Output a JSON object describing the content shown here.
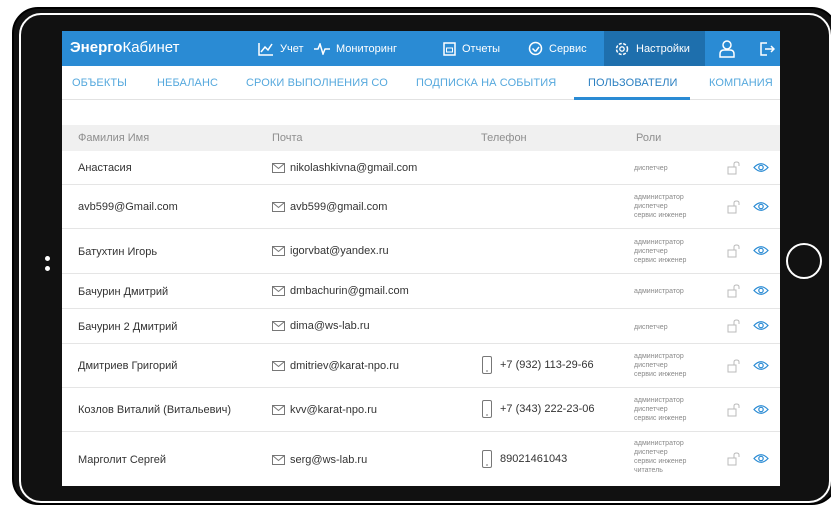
{
  "app": {
    "brand_bold": "Энерго",
    "brand_rest": "Кабинет"
  },
  "nav": {
    "items": [
      {
        "label": "Учет",
        "icon": "chart-icon"
      },
      {
        "label": "Мониторинг",
        "icon": "pulse-icon"
      },
      {
        "label": "Отчеты",
        "icon": "report-icon"
      },
      {
        "label": "Сервис",
        "icon": "service-icon"
      },
      {
        "label": "Настройки",
        "icon": "gear-icon",
        "active": true
      }
    ],
    "user_icon": "user-icon",
    "logout_icon": "logout-icon"
  },
  "tabs": [
    {
      "label": "ОБЪЕКТЫ"
    },
    {
      "label": "НЕБАЛАНС"
    },
    {
      "label": "СРОКИ ВЫПОЛНЕНИЯ СО"
    },
    {
      "label": "ПОДПИСКА НА СОБЫТИЯ"
    },
    {
      "label": "ПОЛЬЗОВАТЕЛИ",
      "active": true
    },
    {
      "label": "КОМПАНИЯ"
    }
  ],
  "table": {
    "headers": {
      "name": "Фамилия Имя",
      "email": "Почта",
      "phone": "Телефон",
      "roles": "Роли"
    },
    "rows": [
      {
        "name": "Анастасия",
        "email": "nikolashkivna@gmail.com",
        "phone": "",
        "roles": [
          "диспетчер"
        ]
      },
      {
        "name": "avb599@Gmail.com",
        "email": "avb599@gmail.com",
        "phone": "",
        "roles": [
          "администратор",
          "диспетчер",
          "сервис инженер"
        ]
      },
      {
        "name": "Батухтин Игорь",
        "email": "igorvbat@yandex.ru",
        "phone": "",
        "roles": [
          "администратор",
          "диспетчер",
          "сервис инженер"
        ]
      },
      {
        "name": "Бачурин Дмитрий",
        "email": "dmbachurin@gmail.com",
        "phone": "",
        "roles": [
          "администратор"
        ]
      },
      {
        "name": "Бачурин 2 Дмитрий",
        "email": "dima@ws-lab.ru",
        "phone": "",
        "roles": [
          "диспетчер"
        ]
      },
      {
        "name": "Дмитриев Григорий",
        "email": "dmitriev@karat-npo.ru",
        "phone": "+7 (932) 113-29-66",
        "roles": [
          "администратор",
          "диспетчер",
          "сервис инженер"
        ]
      },
      {
        "name": "Козлов Виталий (Витальевич)",
        "email": "kvv@karat-npo.ru",
        "phone": "+7 (343) 222-23-06",
        "roles": [
          "администратор",
          "диспетчер",
          "сервис инженер"
        ]
      },
      {
        "name": "Марголит Сергей",
        "email": "serg@ws-lab.ru",
        "phone": "89021461043",
        "roles": [
          "администратор",
          "диспетчер",
          "сервис инженер",
          "читатель"
        ]
      }
    ]
  },
  "colors": {
    "accent": "#2a8bd4",
    "accent_dark": "#1e6fad",
    "tab_text": "#55a8dd",
    "muted_text": "#8e8e8e"
  }
}
